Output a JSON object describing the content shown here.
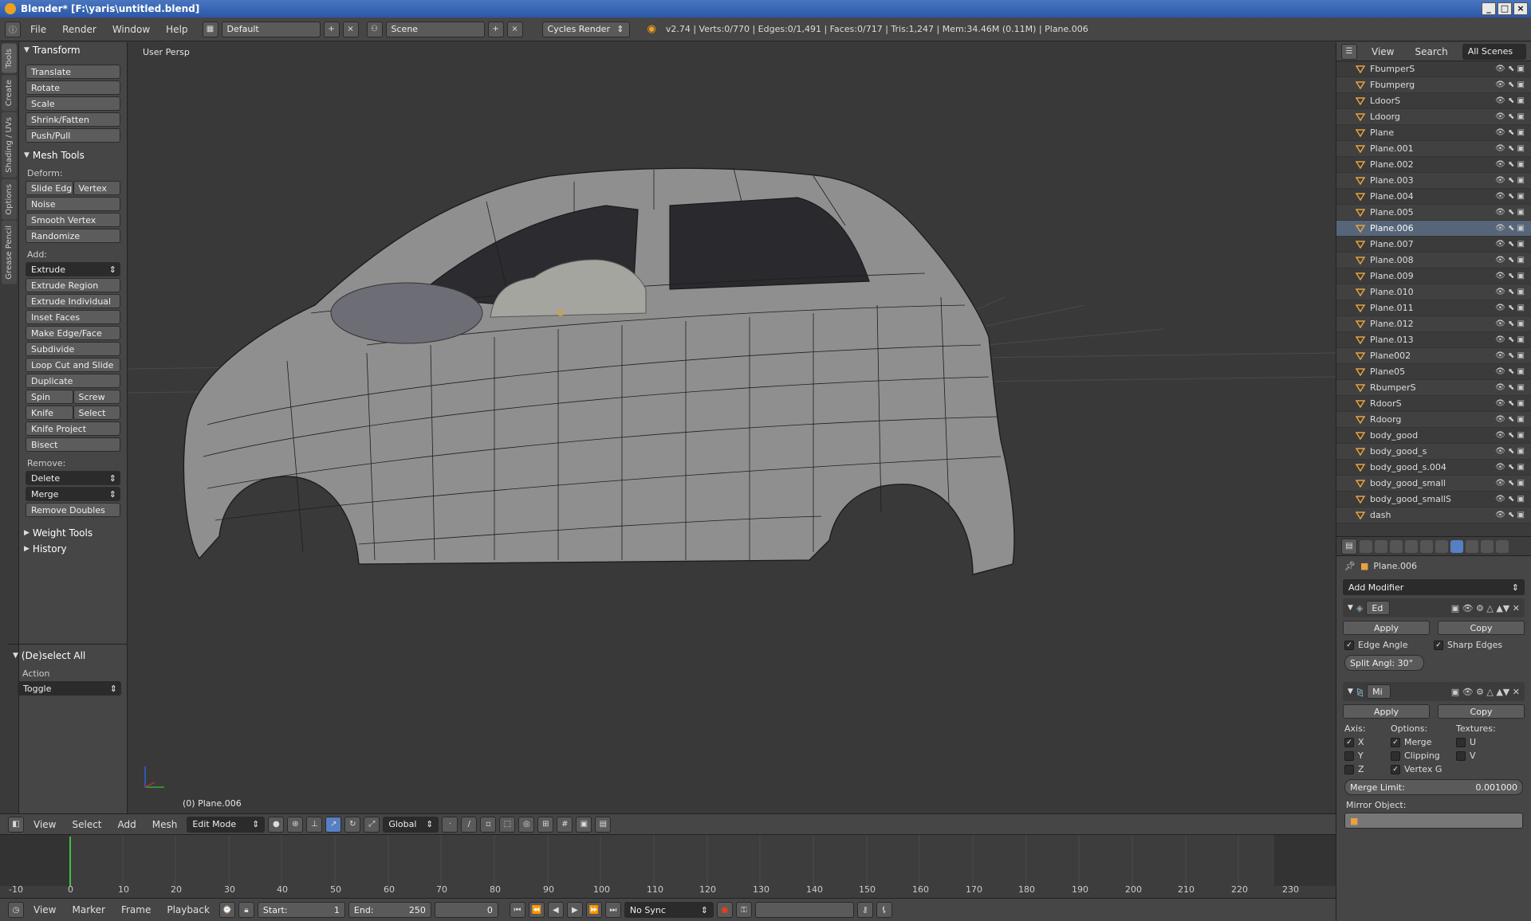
{
  "window": {
    "title": "Blender* [F:\\yaris\\untitled.blend]"
  },
  "info_bar": {
    "menus": [
      "File",
      "Render",
      "Window",
      "Help"
    ],
    "layout": "Default",
    "scene": "Scene",
    "engine": "Cycles Render",
    "stats": "v2.74 | Verts:0/770 | Edges:0/1,491 | Faces:0/717 | Tris:1,247 | Mem:34.46M (0.11M) | Plane.006"
  },
  "left_tabs": [
    "Tools",
    "Create",
    "Shading / UVs",
    "Options",
    "Grease Pencil"
  ],
  "toolshelf": {
    "transform": {
      "title": "Transform",
      "buttons": [
        "Translate",
        "Rotate",
        "Scale",
        "Shrink/Fatten",
        "Push/Pull"
      ]
    },
    "mesh_tools": {
      "title": "Mesh Tools",
      "deform_label": "Deform:",
      "slide_edge": "Slide Edg",
      "vertex": "Vertex",
      "noise": "Noise",
      "smooth_vertex": "Smooth Vertex",
      "randomize": "Randomize",
      "add_label": "Add:",
      "extrude": "Extrude",
      "extrude_region": "Extrude Region",
      "extrude_individual": "Extrude Individual",
      "inset_faces": "Inset Faces",
      "make_edge_face": "Make Edge/Face",
      "subdivide": "Subdivide",
      "loop_cut": "Loop Cut and Slide",
      "duplicate": "Duplicate",
      "spin": "Spin",
      "screw": "Screw",
      "knife": "Knife",
      "select": "Select",
      "knife_project": "Knife Project",
      "bisect": "Bisect",
      "remove_label": "Remove:",
      "delete": "Delete",
      "merge": "Merge",
      "remove_doubles": "Remove Doubles"
    },
    "weight_tools": "Weight Tools",
    "history": "History",
    "operator": {
      "title": "(De)select All",
      "action_label": "Action",
      "action_value": "Toggle"
    }
  },
  "viewport": {
    "view_name": "User Persp",
    "object_label": "(0) Plane.006"
  },
  "view3d_header": {
    "menus": [
      "View",
      "Select",
      "Add",
      "Mesh"
    ],
    "mode": "Edit Mode",
    "orientation": "Global"
  },
  "timeline": {
    "ticks": [
      "-10",
      "0",
      "10",
      "20",
      "30",
      "40",
      "50",
      "60",
      "70",
      "80",
      "90",
      "100",
      "110",
      "120",
      "130",
      "140",
      "150",
      "160",
      "170",
      "180",
      "190",
      "200",
      "210",
      "220",
      "230"
    ],
    "menus": [
      "View",
      "Marker",
      "Frame",
      "Playback"
    ],
    "start_label": "Start:",
    "start_value": "1",
    "end_label": "End:",
    "end_value": "250",
    "current": "0",
    "sync": "No Sync"
  },
  "outliner": {
    "menus": [
      "View",
      "Search"
    ],
    "scope": "All Scenes",
    "items": [
      "FbumperS",
      "Fbumperg",
      "LdoorS",
      "Ldoorg",
      "Plane",
      "Plane.001",
      "Plane.002",
      "Plane.003",
      "Plane.004",
      "Plane.005",
      "Plane.006",
      "Plane.007",
      "Plane.008",
      "Plane.009",
      "Plane.010",
      "Plane.011",
      "Plane.012",
      "Plane.013",
      "Plane002",
      "Plane05",
      "RbumperS",
      "RdoorS",
      "Rdoorg",
      "body_good",
      "body_good_s",
      "body_good_s.004",
      "body_good_small",
      "body_good_smallS",
      "dash"
    ],
    "active_item": "Plane.006"
  },
  "properties": {
    "object_name": "Plane.006",
    "add_modifier": "Add Modifier",
    "edge_split": {
      "name": "Ed",
      "apply": "Apply",
      "copy": "Copy",
      "edge_angle": "Edge Angle",
      "sharp_edges": "Sharp Edges",
      "split_angle": "Split Angl: 30°"
    },
    "mirror": {
      "name": "Mi",
      "apply": "Apply",
      "copy": "Copy",
      "axis_label": "Axis:",
      "options_label": "Options:",
      "textures_label": "Textures:",
      "x": "X",
      "y": "Y",
      "z": "Z",
      "merge": "Merge",
      "clipping": "Clipping",
      "vertex_g": "Vertex G",
      "u": "U",
      "v": "V",
      "merge_limit_label": "Merge Limit:",
      "merge_limit_value": "0.001000",
      "mirror_object_label": "Mirror Object:"
    }
  },
  "colors": {
    "accent": "#5680c2",
    "grid": "#4a4a4a",
    "x_axis": "#c03030",
    "y_axis": "#40a040",
    "z_axis": "#3060d0",
    "frame_marker": "#40c040"
  }
}
